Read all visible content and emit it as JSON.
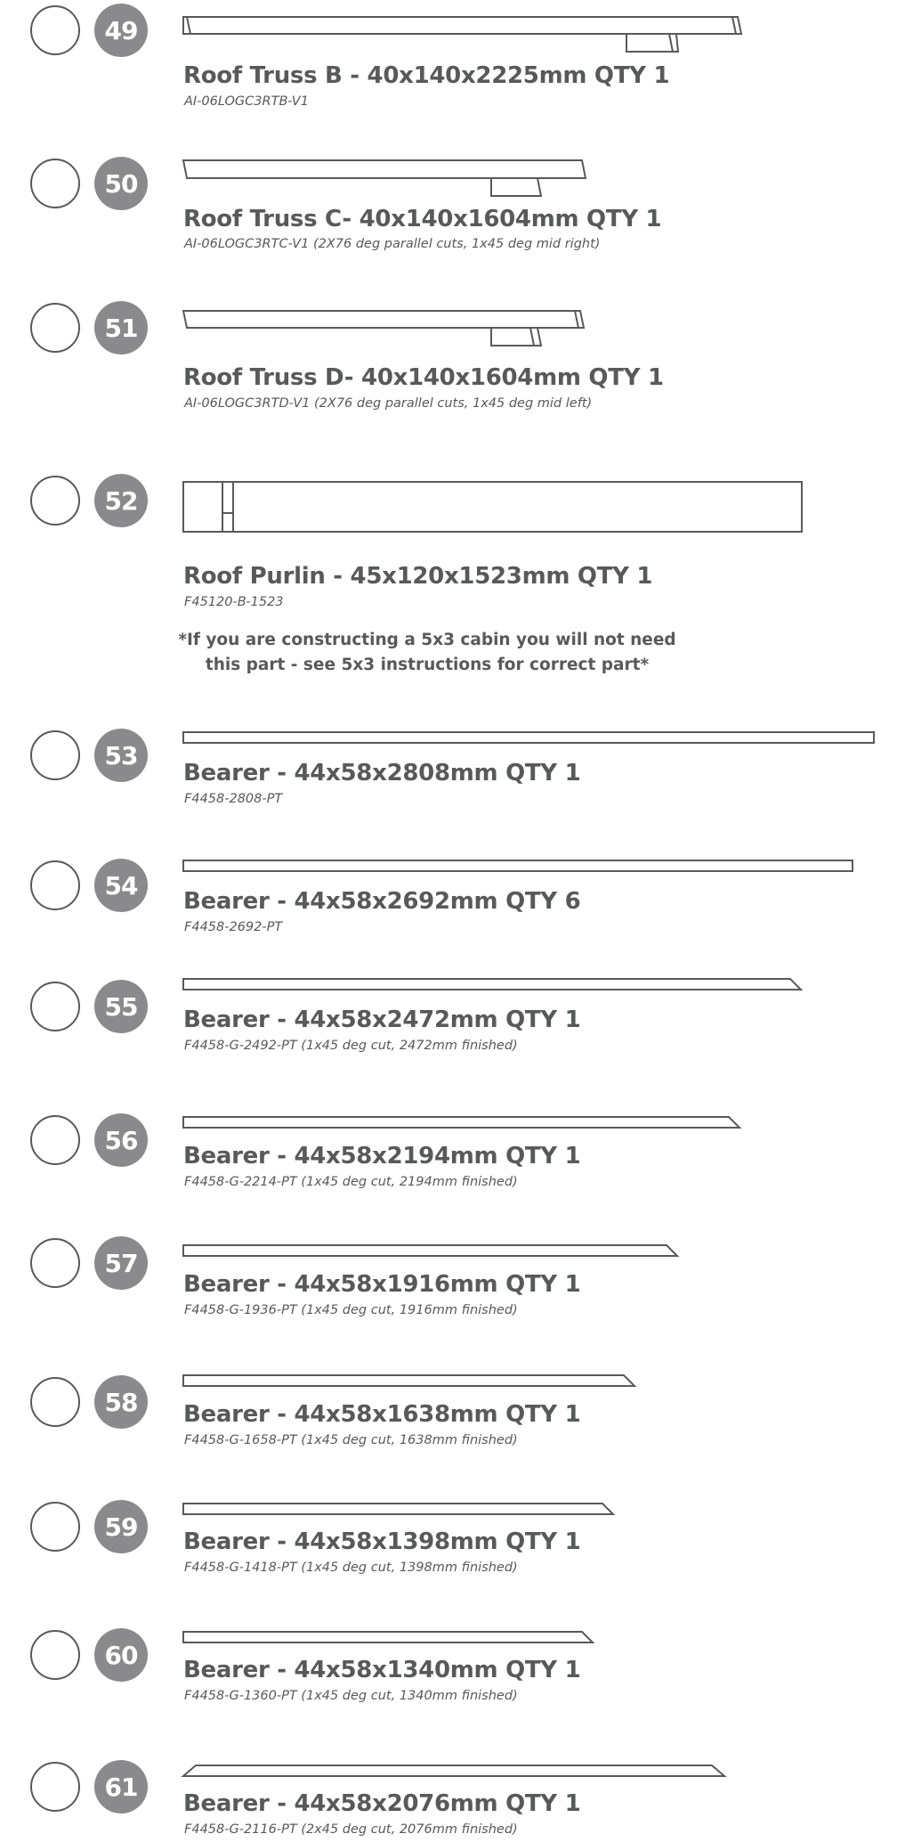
{
  "parts": [
    {
      "number": "49",
      "title": "Roof Truss B - 40x140x2225mm QTY 1",
      "code": "AI-06LOGC3RTB-V1"
    },
    {
      "number": "50",
      "title": "Roof Truss C- 40x140x1604mm QTY 1",
      "code": "AI-06LOGC3RTC-V1 (2X76 deg parallel cuts, 1x45 deg mid right)"
    },
    {
      "number": "51",
      "title": "Roof Truss D- 40x140x1604mm QTY 1",
      "code": "AI-06LOGC3RTD-V1 (2X76 deg parallel cuts, 1x45 deg mid left)"
    },
    {
      "number": "52",
      "title": "Roof Purlin - 45x120x1523mm QTY 1",
      "code": "F45120-B-1523"
    },
    {
      "number": "53",
      "title": "Bearer - 44x58x2808mm QTY 1",
      "code": "F4458-2808-PT"
    },
    {
      "number": "54",
      "title": "Bearer - 44x58x2692mm QTY 6",
      "code": "F4458-2692-PT"
    },
    {
      "number": "55",
      "title": "Bearer - 44x58x2472mm QTY 1",
      "code": "F4458-G-2492-PT (1x45 deg cut, 2472mm finished)"
    },
    {
      "number": "56",
      "title": "Bearer - 44x58x2194mm QTY 1",
      "code": "F4458-G-2214-PT (1x45 deg cut, 2194mm finished)"
    },
    {
      "number": "57",
      "title": "Bearer - 44x58x1916mm QTY 1",
      "code": "F4458-G-1936-PT (1x45 deg cut, 1916mm finished)"
    },
    {
      "number": "58",
      "title": "Bearer - 44x58x1638mm QTY 1",
      "code": "F4458-G-1658-PT (1x45 deg cut, 1638mm finished)"
    },
    {
      "number": "59",
      "title": "Bearer - 44x58x1398mm QTY 1",
      "code": "F4458-G-1418-PT (1x45 deg cut, 1398mm finished)"
    },
    {
      "number": "60",
      "title": "Bearer - 44x58x1340mm QTY 1",
      "code": "F4458-G-1360-PT (1x45 deg cut, 1340mm finished)"
    },
    {
      "number": "61",
      "title": "Bearer - 44x58x2076mm QTY 1",
      "code": "F4458-G-2116-PT (2x45 deg cut, 2076mm finished)"
    }
  ],
  "note": {
    "line1": "*If you are constructing a 5x3 cabin you will not need",
    "line2": "this part - see 5x3 instructions for correct part*"
  }
}
